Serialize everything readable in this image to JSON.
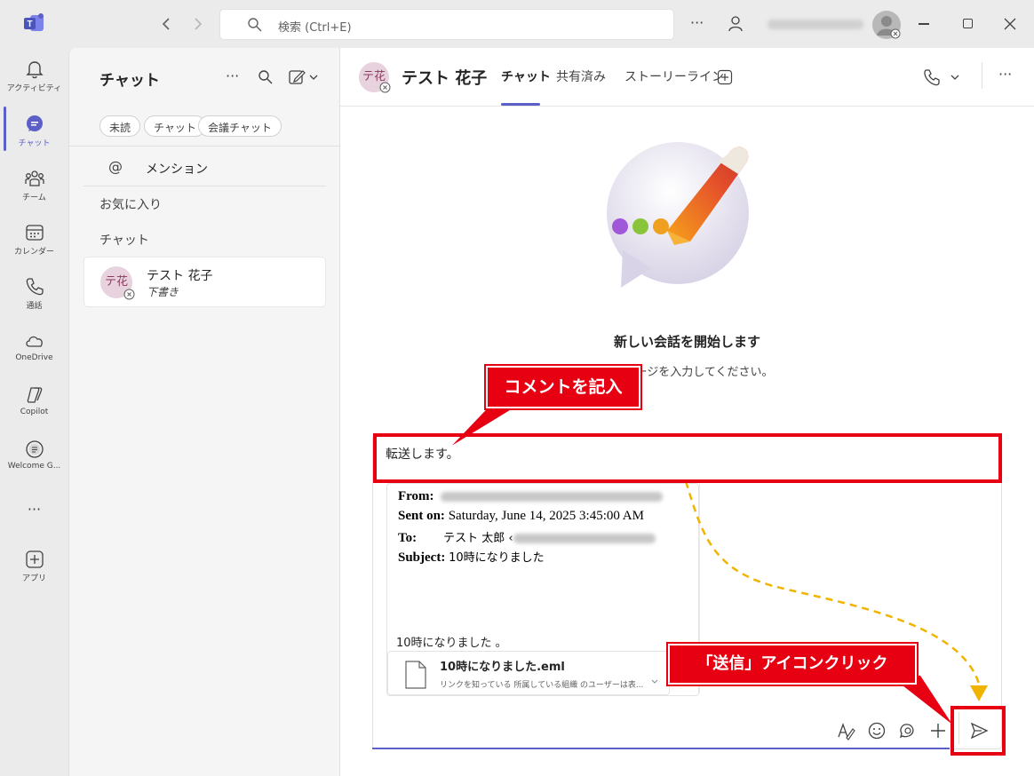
{
  "titlebar": {
    "search_placeholder": "検索 (Ctrl+E)",
    "more": "···"
  },
  "rail": {
    "items": [
      {
        "label": "アクティビティ",
        "icon": "bell-icon"
      },
      {
        "label": "チャット",
        "icon": "chat-icon",
        "active": true
      },
      {
        "label": "チーム",
        "icon": "teams-icon"
      },
      {
        "label": "カレンダー",
        "icon": "calendar-icon"
      },
      {
        "label": "通話",
        "icon": "phone-icon"
      },
      {
        "label": "OneDrive",
        "icon": "cloud-icon"
      },
      {
        "label": "Copilot",
        "icon": "copilot-icon"
      },
      {
        "label": "Welcome G...",
        "icon": "welcome-icon"
      },
      {
        "label": "···",
        "icon": "more-icon"
      },
      {
        "label": "アプリ",
        "icon": "add-app-icon"
      }
    ]
  },
  "chatlist": {
    "title": "チャット",
    "more": "···",
    "filters": [
      "未読",
      "チャット",
      "会議チャット"
    ],
    "mention_label": "メンション",
    "mention_symbol": "@",
    "favorites_label": "お気に入り",
    "chats_section_label": "チャット",
    "chats": [
      {
        "avatar_text": "テ花",
        "name": "テスト 花子",
        "preview": "下書き"
      }
    ]
  },
  "header": {
    "avatar_text": "テ花",
    "name": "テスト 花子",
    "tabs": [
      "チャット",
      "共有済み",
      "ストーリーライン"
    ],
    "active_tab": "チャット",
    "more": "···"
  },
  "main": {
    "start_title": "新しい会話を開始します",
    "start_subtitle": "メッセージを入力してください。"
  },
  "compose": {
    "text": "転送します。",
    "email": {
      "from_label": "From:",
      "sent_label": "Sent on:",
      "sent_value": "Saturday, June 14, 2025 3:45:00 AM",
      "to_label": "To:",
      "to_value": "テスト 太郎 ‹",
      "subject_label": "Subject:",
      "subject_value": "10時になりました",
      "body": "10時になりました 。",
      "attachment_name": "10時になりました.eml",
      "attachment_desc": "リンクを知っている 所属している組織 のユーザーは表..."
    }
  },
  "annotations": {
    "comment_callout": "コメントを記入",
    "send_callout": "「送信」アイコンクリック",
    "colors": {
      "annotation_red": "#e60012",
      "arrow_yellow": "#f0b400",
      "accent": "#5b5fc7"
    }
  }
}
